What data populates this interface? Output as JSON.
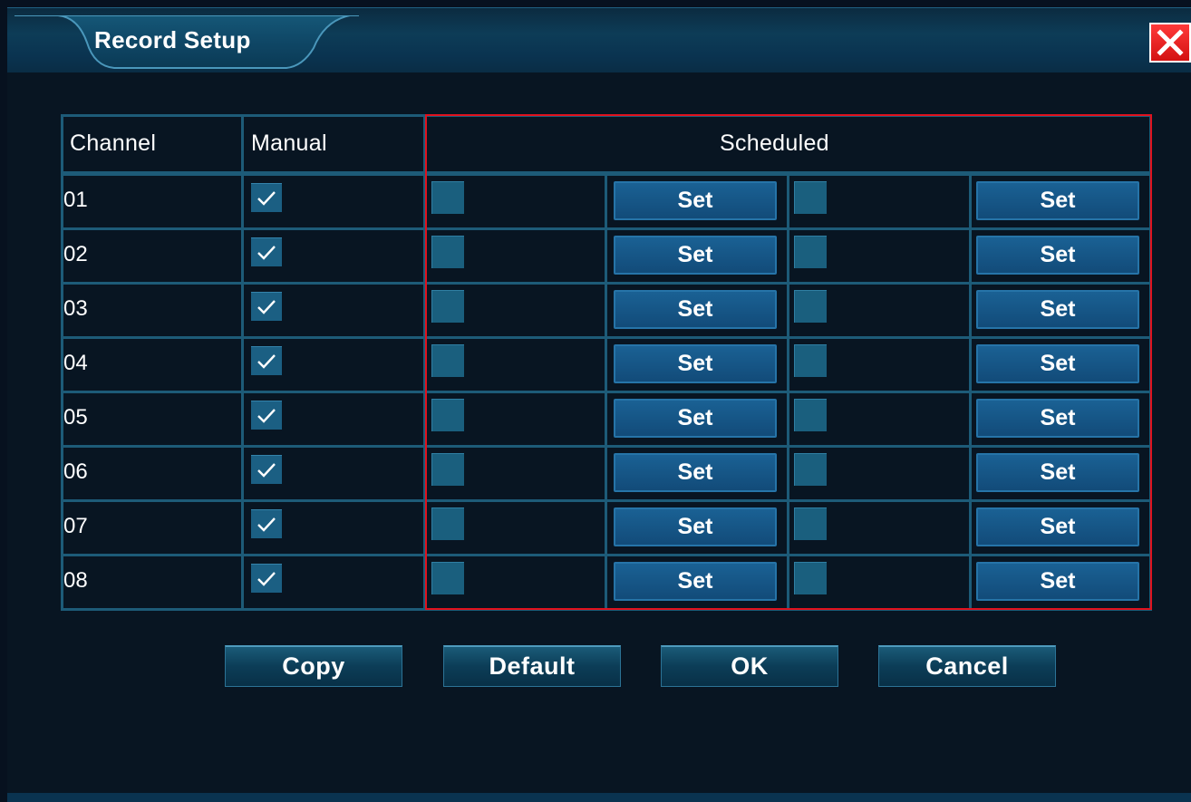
{
  "window": {
    "title": "Record Setup",
    "close_icon": "close-x-icon",
    "colors": {
      "background": "#07111f",
      "grid": "#1d5b78",
      "highlight_frame": "#e0121e",
      "button": "#124b79"
    }
  },
  "table": {
    "headers": {
      "channel": "Channel",
      "manual": "Manual",
      "scheduled": "Scheduled"
    },
    "set_label": "Set",
    "rows": [
      {
        "channel": "01",
        "manual": true,
        "sched1": false,
        "sched2": false
      },
      {
        "channel": "02",
        "manual": true,
        "sched1": false,
        "sched2": false
      },
      {
        "channel": "03",
        "manual": true,
        "sched1": false,
        "sched2": false
      },
      {
        "channel": "04",
        "manual": true,
        "sched1": false,
        "sched2": false
      },
      {
        "channel": "05",
        "manual": true,
        "sched1": false,
        "sched2": false
      },
      {
        "channel": "06",
        "manual": true,
        "sched1": false,
        "sched2": false
      },
      {
        "channel": "07",
        "manual": true,
        "sched1": false,
        "sched2": false
      },
      {
        "channel": "08",
        "manual": true,
        "sched1": false,
        "sched2": false
      }
    ]
  },
  "buttons": {
    "copy": "Copy",
    "default": "Default",
    "ok": "OK",
    "cancel": "Cancel"
  }
}
